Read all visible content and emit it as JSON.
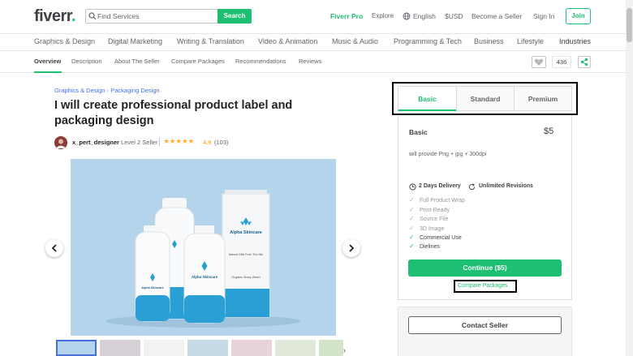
{
  "header": {
    "logo": "fiverr",
    "logo_dot": ".",
    "search_placeholder": "Find Services",
    "search_button": "Search",
    "fiverr_pro": "Fiverr Pro",
    "explore": "Explore",
    "language": "English",
    "currency": "$USD",
    "become_seller": "Become a Seller",
    "sign_in": "Sign In",
    "join": "Join"
  },
  "categories": [
    "Graphics & Design",
    "Digital Marketing",
    "Writing & Translation",
    "Video & Animation",
    "Music & Audio",
    "Programming & Tech",
    "Business",
    "Lifestyle",
    "Industries"
  ],
  "subnav": {
    "items": [
      "Overview",
      "Description",
      "About The Seller",
      "Compare Packages",
      "Recommendations",
      "Reviews"
    ],
    "likes": "436"
  },
  "gig": {
    "breadcrumb_cat": "Graphics & Design",
    "breadcrumb_sep": "›",
    "breadcrumb_sub": "Packaging Design",
    "title": "I will create professional product label and packaging design",
    "seller": "x_pert_designer",
    "level": "Level 2 Seller",
    "stars": "★★★★★",
    "rating": "4.9",
    "reviews": "(103)",
    "product_brand": "Alpha Skincare",
    "product_tagline": "Natural Gifts From The Nile",
    "product_type": "Organic Body Wash"
  },
  "packages": {
    "tabs": [
      "Basic",
      "Standard",
      "Premium"
    ],
    "active_tab": "Basic",
    "name": "Basic",
    "price": "$5",
    "description": "will provide Png + jpg + 300dpi",
    "delivery": "2 Days Delivery",
    "revisions": "Unlimited Revisions",
    "features": [
      {
        "label": "Full Product Wrap",
        "included": false
      },
      {
        "label": "Print-Ready",
        "included": false
      },
      {
        "label": "Source File",
        "included": false
      },
      {
        "label": "3D Image",
        "included": false
      },
      {
        "label": "Commercial Use",
        "included": true
      },
      {
        "label": "Dielines",
        "included": true
      }
    ],
    "continue": "Continue ($5)",
    "compare": "Compare Packages",
    "contact": "Contact Seller"
  },
  "colors": {
    "brand_green": "#1dbf73",
    "link_blue": "#446ee7",
    "star_yellow": "#ffb33e",
    "product_blue": "#2a9fd6"
  }
}
